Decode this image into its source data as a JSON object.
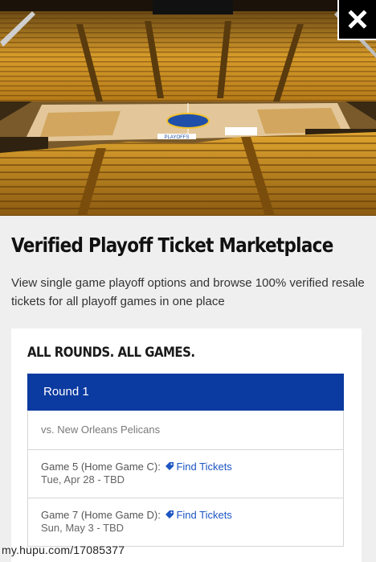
{
  "modal": {
    "close_icon": "close-icon"
  },
  "hero": {
    "image": "arena-photo",
    "court_signs": [
      "PLAYOFFS"
    ]
  },
  "title": "Verified Playoff Ticket Marketplace",
  "description": "View single game playoff options and browse 100% verified resale tickets for all playoff games in one place",
  "card": {
    "heading": "ALL ROUNDS. ALL GAMES.",
    "round": {
      "label": "Round 1",
      "opponent": "vs. New Orleans Pelicans",
      "games": [
        {
          "title": "Game 5 (Home Game C):",
          "link_label": "Find Tickets",
          "date": "Tue, Apr 28 - TBD",
          "icon": "ticket-tag-icon"
        },
        {
          "title": "Game 7 (Home Game D):",
          "link_label": "Find Tickets",
          "date": "Sun, May 3 - TBD",
          "icon": "ticket-tag-icon"
        }
      ]
    }
  },
  "watermark": "my.hupu.com/17085377",
  "colors": {
    "accent_blue": "#0b3aa0",
    "link_blue": "#1d56c2",
    "background": "#efefef"
  }
}
